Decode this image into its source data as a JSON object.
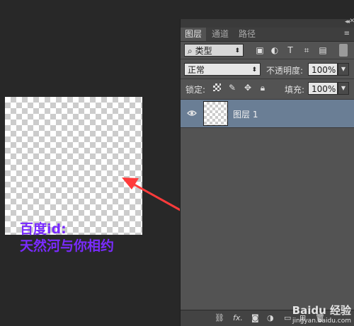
{
  "panel": {
    "tabs": [
      {
        "label": "图层",
        "active": true
      },
      {
        "label": "通道",
        "active": false
      },
      {
        "label": "路径",
        "active": false
      }
    ],
    "filter": {
      "label": "类型",
      "icon": "search-icon"
    },
    "blend_mode": {
      "value": "正常"
    },
    "opacity": {
      "label": "不透明度:",
      "value": "100%"
    },
    "lock": {
      "label": "锁定:"
    },
    "fill": {
      "label": "填充:",
      "value": "100%"
    },
    "layers": [
      {
        "name": "图层 1",
        "visible": true,
        "selected": true
      }
    ],
    "bottom_icons": [
      "link-icon",
      "fx-icon",
      "mask-icon",
      "adjustment-icon",
      "folder-icon",
      "new-layer-icon",
      "trash-icon"
    ],
    "fx_label": "fx."
  },
  "annotation": {
    "line1": "百度id:",
    "line2": "天然河与你相约",
    "color": "#7a2bff",
    "arrow_color": "#ff3b3b"
  },
  "watermark": {
    "brand": "Baidu 经验",
    "url": "jingyan.baidu.com"
  },
  "colors": {
    "background": "#282828",
    "panel": "#535353",
    "selected_layer": "#6a7e95"
  }
}
